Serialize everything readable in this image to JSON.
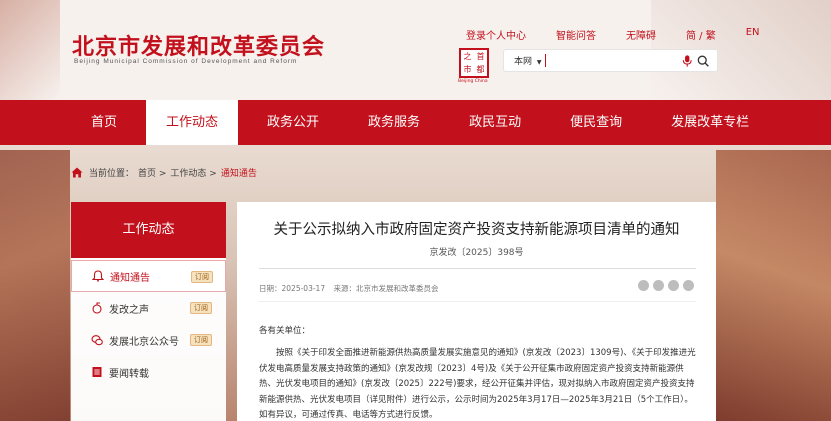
{
  "header": {
    "title": "北京市发展和改革委员会",
    "subtitle": "Beijing Municipal Commission of Development and Reform",
    "top_links": [
      "登录个人中心",
      "智能问答",
      "无障碍",
      "简 / 繁",
      "EN"
    ],
    "seal_chars": [
      "之",
      "首",
      "市",
      "都"
    ],
    "seal_caption": "Beijing China",
    "search": {
      "scope": "本网",
      "placeholder": ""
    }
  },
  "nav": {
    "items": [
      "首页",
      "工作动态",
      "政务公开",
      "政务服务",
      "政民互动",
      "便民查询",
      "发展改革专栏"
    ],
    "active": "工作动态"
  },
  "breadcrumb": {
    "label": "当前位置：",
    "crumbs": [
      "首页 >",
      "工作动态 >",
      "通知通告"
    ]
  },
  "sidebar": {
    "title": "工作动态",
    "items": [
      {
        "label": "通知通告",
        "badge": "订阅",
        "icon": "bell-icon"
      },
      {
        "label": "发改之声",
        "badge": "订阅",
        "icon": "voice-icon"
      },
      {
        "label": "发展北京公众号",
        "badge": "订阅",
        "icon": "wechat-icon"
      },
      {
        "label": "要闻转载",
        "badge": "",
        "icon": "document-icon"
      }
    ]
  },
  "article": {
    "title": "关于公示拟纳入市政府固定资产投资支持新能源项目清单的通知",
    "doc_no": "京发改〔2025〕398号",
    "date": "日期：2025-03-17",
    "source": "来源：北京市发展和改革委员会",
    "salutation": "各有关单位：",
    "body": "按照《关于印发全面推进新能源供热高质量发展实施意见的通知》(京发改〔2023〕1309号)、《关于印发推进光伏发电高质量发展支持政策的通知》(京发改规〔2023〕4号)及《关于公开征集市政府固定资产投资支持新能源供热、光伏发电项目的通知》(京发改〔2025〕222号)要求，经公开征集并评估，现对拟纳入市政府固定资产投资支持新能源供热、光伏发电项目（详见附件）进行公示，公示时间为2025年3月17日—2025年3月21日（5个工作日）。如有异议，可通过传真、电话等方式进行反馈。"
  },
  "colors": {
    "brand_red": "#c2111c",
    "badge_bg": "#f6e2bf"
  }
}
